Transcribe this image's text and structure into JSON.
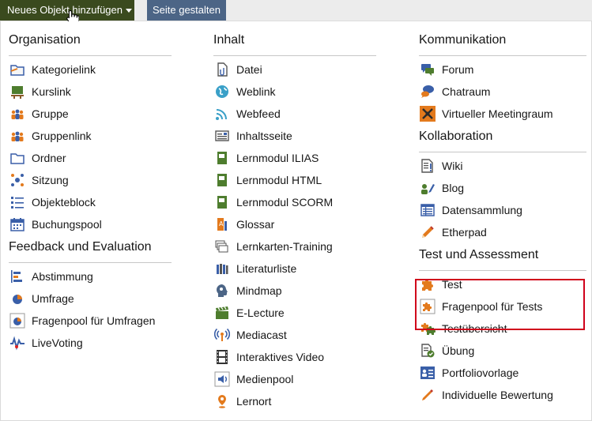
{
  "toolbar": {
    "add_label": "Neues Objekt hinzufügen",
    "layout_label": "Seite gestalten"
  },
  "menu": {
    "organisation": {
      "title": "Organisation",
      "items": [
        "Kategorielink",
        "Kurslink",
        "Gruppe",
        "Gruppenlink",
        "Ordner",
        "Sitzung",
        "Objekteblock",
        "Buchungspool"
      ]
    },
    "feedback": {
      "title": "Feedback und Evaluation",
      "items": [
        "Abstimmung",
        "Umfrage",
        "Fragenpool für Umfragen",
        "LiveVoting"
      ]
    },
    "inhalt": {
      "title": "Inhalt",
      "items": [
        "Datei",
        "Weblink",
        "Webfeed",
        "Inhaltsseite",
        "Lernmodul ILIAS",
        "Lernmodul HTML",
        "Lernmodul SCORM",
        "Glossar",
        "Lernkarten-Training",
        "Literaturliste",
        "Mindmap",
        "E-Lecture",
        "Mediacast",
        "Interaktives Video",
        "Medienpool",
        "Lernort"
      ]
    },
    "kommunikation": {
      "title": "Kommunikation",
      "items": [
        "Forum",
        "Chatraum",
        "Virtueller Meetingraum"
      ]
    },
    "kollaboration": {
      "title": "Kollaboration",
      "items": [
        "Wiki",
        "Blog",
        "Datensammlung",
        "Etherpad"
      ]
    },
    "test": {
      "title": "Test und Assessment",
      "items": [
        "Test",
        "Fragenpool für Tests",
        "Testübersicht",
        "Übung",
        "Portfoliovorlage",
        "Individuelle Bewertung"
      ]
    }
  },
  "colors": {
    "add_button": "#3a4a1e",
    "layout_button": "#4c6586",
    "highlight": "#d0021b"
  }
}
